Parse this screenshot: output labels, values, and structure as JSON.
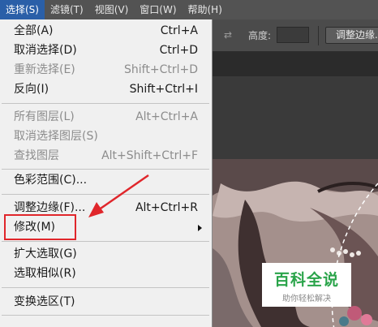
{
  "menubar": {
    "items": [
      "选择(S)",
      "滤镜(T)",
      "视图(V)",
      "窗口(W)",
      "帮助(H)"
    ]
  },
  "options_bar": {
    "height_label": "高度:",
    "refine_button_label": "调整边缘..."
  },
  "menu": {
    "items": [
      {
        "label": "全部(A)",
        "shortcut": "Ctrl+A",
        "enabled": true
      },
      {
        "label": "取消选择(D)",
        "shortcut": "Ctrl+D",
        "enabled": true
      },
      {
        "label": "重新选择(E)",
        "shortcut": "Shift+Ctrl+D",
        "enabled": false
      },
      {
        "label": "反向(I)",
        "shortcut": "Shift+Ctrl+I",
        "enabled": true
      },
      {
        "label": "所有图层(L)",
        "shortcut": "Alt+Ctrl+A",
        "enabled": false
      },
      {
        "label": "取消选择图层(S)",
        "shortcut": "",
        "enabled": false
      },
      {
        "label": "查找图层",
        "shortcut": "Alt+Shift+Ctrl+F",
        "enabled": false
      },
      {
        "label": "色彩范围(C)...",
        "shortcut": "",
        "enabled": true
      },
      {
        "label": "调整边缘(F)...",
        "shortcut": "Alt+Ctrl+R",
        "enabled": true
      },
      {
        "label": "修改(M)",
        "shortcut": "",
        "enabled": true,
        "submenu": true
      },
      {
        "label": "扩大选取(G)",
        "shortcut": "",
        "enabled": true
      },
      {
        "label": "选取相似(R)",
        "shortcut": "",
        "enabled": true
      },
      {
        "label": "变换选区(T)",
        "shortcut": "",
        "enabled": true
      }
    ]
  },
  "watermark": {
    "title": "百科全说",
    "subtitle": "助你轻松解决"
  },
  "colors": {
    "annotation_red": "#e0262b",
    "watermark_green": "#2aa44a",
    "menu_highlight": "#2a5fa8"
  }
}
